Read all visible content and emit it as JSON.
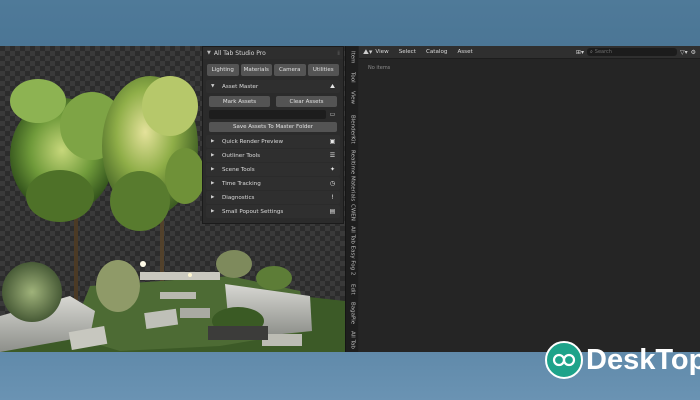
{
  "npanel": {
    "title": "All Tab Studio Pro",
    "tabs": [
      "Lighting",
      "Materials",
      "Camera",
      "Utilities"
    ],
    "asset_master": {
      "label": "Asset Master",
      "mark_assets": "Mark Assets",
      "clear_assets": "Clear Assets",
      "save_button": "Save Assets To Master Folder"
    },
    "sections": [
      {
        "label": "Quick Render Preview",
        "icon": "render-preview-icon"
      },
      {
        "label": "Outliner Tools",
        "icon": "outliner-icon"
      },
      {
        "label": "Scene Tools",
        "icon": "scene-icon"
      },
      {
        "label": "Time Tracking",
        "icon": "clock-icon"
      },
      {
        "label": "Diagnostics",
        "icon": "diagnostics-icon"
      },
      {
        "label": "Small Popout Settings",
        "icon": "popout-icon"
      }
    ]
  },
  "vertical_tabs": [
    "Item",
    "Tool",
    "View",
    "BlenderKit",
    "Realtime Materials",
    "CWEN",
    "All Tab Easy Fog 2",
    "Edit",
    "BagaPie",
    "All Tab"
  ],
  "browser": {
    "menus": [
      "View",
      "Select",
      "Catalog",
      "Asset"
    ],
    "search_placeholder": "Search",
    "empty_text": "No items"
  },
  "watermark": {
    "text": "DeskTop",
    "icon": "ring-logo-icon"
  }
}
